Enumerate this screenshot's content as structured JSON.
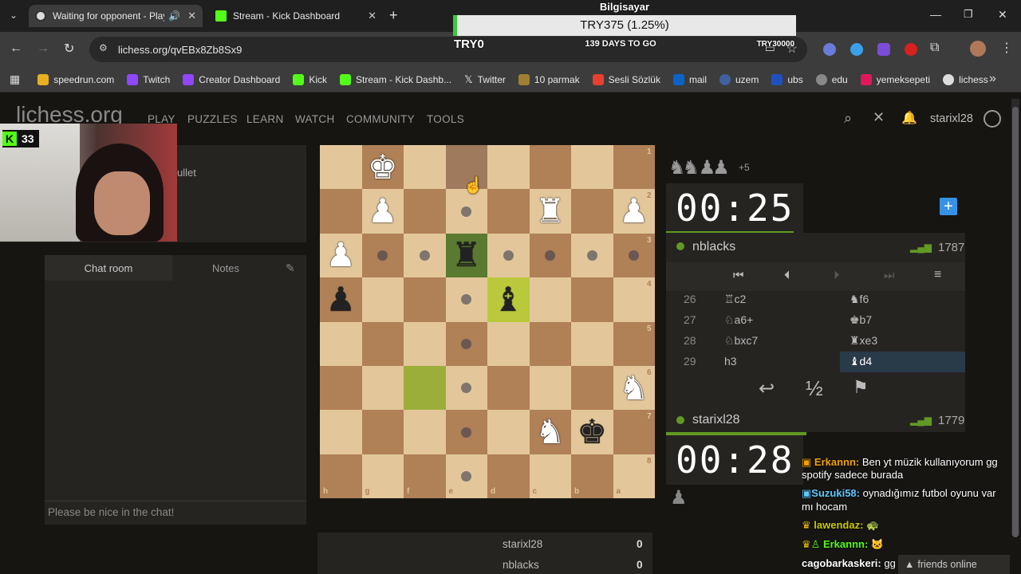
{
  "browser": {
    "tabs": [
      {
        "title": "Waiting for opponent - Play",
        "active": true
      },
      {
        "title": "Stream - Kick Dashboard",
        "active": false
      }
    ],
    "new_tab": "+",
    "url": "lichess.org/qvEBx8Zb8Sx9",
    "bookmarks": [
      "speedrun.com",
      "Twitch",
      "Creator Dashboard",
      "Kick",
      "Stream - Kick Dashb...",
      "Twitter",
      "10 parmak",
      "Sesli Sözlük",
      "mail",
      "uzem",
      "ubs",
      "edu",
      "yemeksepeti",
      "lichess"
    ],
    "bookmarks_more": "»"
  },
  "overlay": {
    "machine": "Bilgisayar",
    "progress_text": "TRY375 (1.25%)",
    "progress_pct": 1.25,
    "left_label": "TRY0",
    "center_label": "139 DAYS TO GO",
    "right_label": "TRY30000"
  },
  "lichess": {
    "logo": "lichess.org",
    "nav": [
      "PLAY",
      "PUZZLES",
      "LEARN",
      "WATCH",
      "COMMUNITY",
      "TOOLS"
    ],
    "username": "starixl28",
    "kick_badge": "33",
    "game_type_fragment": "ullet"
  },
  "chat": {
    "tabs": [
      "Chat room",
      "Notes"
    ],
    "placeholder": "Please be nice in the chat!"
  },
  "board": {
    "files_bottom": [
      "h",
      "g",
      "f",
      "e",
      "d",
      "c",
      "b",
      "a"
    ],
    "ranks_right": [
      "1",
      "2",
      "3",
      "4",
      "5",
      "6",
      "7",
      "8"
    ]
  },
  "game": {
    "captured_count": "+5",
    "top_clock": "00:25",
    "bottom_clock": "00:28",
    "top_player": {
      "name": "nblacks",
      "rating": "1787"
    },
    "bottom_player": {
      "name": "starixl28",
      "rating": "1779"
    },
    "moves": [
      {
        "num": "26",
        "white": "♖c2",
        "black": "♞f6"
      },
      {
        "num": "27",
        "white": "♘a6+",
        "black": "♚b7"
      },
      {
        "num": "28",
        "white": "♘bxc7",
        "black": "♜xe3"
      },
      {
        "num": "29",
        "white": "h3",
        "black": "♝d4"
      }
    ],
    "draw_symbol": "½"
  },
  "crosstable": [
    {
      "name": "starixl28",
      "score": "0"
    },
    {
      "name": "nblacks",
      "score": "0"
    }
  ],
  "stream_chat": [
    {
      "user": "Erkannn:",
      "text": " Ben yt müzik kullanıyorum gg",
      "user_color": "#f0a000"
    },
    {
      "user": "",
      "text": "spotify sadece burada",
      "user_color": "#ffffff"
    },
    {
      "user": "Suzuki58:",
      "text": " oynadığımız futbol oyunu var",
      "user_color": "#5ec8ff"
    },
    {
      "user": "",
      "text": "mı hocam",
      "user_color": "#ffffff"
    },
    {
      "user": "lawendaz:",
      "text": " ",
      "user_color": "#c8c800"
    },
    {
      "user": "Erkannn:",
      "text": " ",
      "user_color": "#53fc18"
    },
    {
      "user": "cagobarkaskeri:",
      "text": " gg",
      "user_color": "#ffffff"
    }
  ],
  "friends_online": "friends online",
  "colors": {
    "accent": "#629924",
    "board_light": "#e3c79b",
    "board_dark": "#b08056"
  }
}
